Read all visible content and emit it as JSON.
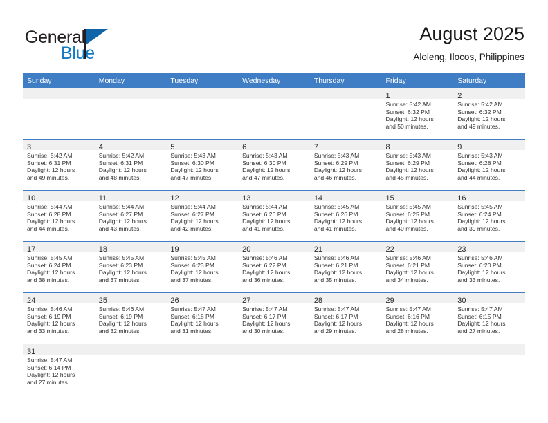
{
  "brand": {
    "name_dark": "General",
    "name_blue": "Blue",
    "flag_icon": "triangle-flag-icon",
    "accent_color": "#1279c4"
  },
  "header": {
    "title": "August 2025",
    "subtitle": "Aloleng, Ilocos, Philippines",
    "header_bg_color": "#3f7dc4",
    "daynum_strip_color": "#f0f0f0"
  },
  "weekday_headers": [
    "Sunday",
    "Monday",
    "Tuesday",
    "Wednesday",
    "Thursday",
    "Friday",
    "Saturday"
  ],
  "weeks": [
    [
      {
        "day": "",
        "lines": []
      },
      {
        "day": "",
        "lines": []
      },
      {
        "day": "",
        "lines": []
      },
      {
        "day": "",
        "lines": []
      },
      {
        "day": "",
        "lines": []
      },
      {
        "day": "1",
        "lines": [
          "Sunrise: 5:42 AM",
          "Sunset: 6:32 PM",
          "Daylight: 12 hours",
          "and 50 minutes."
        ]
      },
      {
        "day": "2",
        "lines": [
          "Sunrise: 5:42 AM",
          "Sunset: 6:32 PM",
          "Daylight: 12 hours",
          "and 49 minutes."
        ]
      }
    ],
    [
      {
        "day": "3",
        "lines": [
          "Sunrise: 5:42 AM",
          "Sunset: 6:31 PM",
          "Daylight: 12 hours",
          "and 49 minutes."
        ]
      },
      {
        "day": "4",
        "lines": [
          "Sunrise: 5:42 AM",
          "Sunset: 6:31 PM",
          "Daylight: 12 hours",
          "and 48 minutes."
        ]
      },
      {
        "day": "5",
        "lines": [
          "Sunrise: 5:43 AM",
          "Sunset: 6:30 PM",
          "Daylight: 12 hours",
          "and 47 minutes."
        ]
      },
      {
        "day": "6",
        "lines": [
          "Sunrise: 5:43 AM",
          "Sunset: 6:30 PM",
          "Daylight: 12 hours",
          "and 47 minutes."
        ]
      },
      {
        "day": "7",
        "lines": [
          "Sunrise: 5:43 AM",
          "Sunset: 6:29 PM",
          "Daylight: 12 hours",
          "and 46 minutes."
        ]
      },
      {
        "day": "8",
        "lines": [
          "Sunrise: 5:43 AM",
          "Sunset: 6:29 PM",
          "Daylight: 12 hours",
          "and 45 minutes."
        ]
      },
      {
        "day": "9",
        "lines": [
          "Sunrise: 5:43 AM",
          "Sunset: 6:28 PM",
          "Daylight: 12 hours",
          "and 44 minutes."
        ]
      }
    ],
    [
      {
        "day": "10",
        "lines": [
          "Sunrise: 5:44 AM",
          "Sunset: 6:28 PM",
          "Daylight: 12 hours",
          "and 44 minutes."
        ]
      },
      {
        "day": "11",
        "lines": [
          "Sunrise: 5:44 AM",
          "Sunset: 6:27 PM",
          "Daylight: 12 hours",
          "and 43 minutes."
        ]
      },
      {
        "day": "12",
        "lines": [
          "Sunrise: 5:44 AM",
          "Sunset: 6:27 PM",
          "Daylight: 12 hours",
          "and 42 minutes."
        ]
      },
      {
        "day": "13",
        "lines": [
          "Sunrise: 5:44 AM",
          "Sunset: 6:26 PM",
          "Daylight: 12 hours",
          "and 41 minutes."
        ]
      },
      {
        "day": "14",
        "lines": [
          "Sunrise: 5:45 AM",
          "Sunset: 6:26 PM",
          "Daylight: 12 hours",
          "and 41 minutes."
        ]
      },
      {
        "day": "15",
        "lines": [
          "Sunrise: 5:45 AM",
          "Sunset: 6:25 PM",
          "Daylight: 12 hours",
          "and 40 minutes."
        ]
      },
      {
        "day": "16",
        "lines": [
          "Sunrise: 5:45 AM",
          "Sunset: 6:24 PM",
          "Daylight: 12 hours",
          "and 39 minutes."
        ]
      }
    ],
    [
      {
        "day": "17",
        "lines": [
          "Sunrise: 5:45 AM",
          "Sunset: 6:24 PM",
          "Daylight: 12 hours",
          "and 38 minutes."
        ]
      },
      {
        "day": "18",
        "lines": [
          "Sunrise: 5:45 AM",
          "Sunset: 6:23 PM",
          "Daylight: 12 hours",
          "and 37 minutes."
        ]
      },
      {
        "day": "19",
        "lines": [
          "Sunrise: 5:45 AM",
          "Sunset: 6:23 PM",
          "Daylight: 12 hours",
          "and 37 minutes."
        ]
      },
      {
        "day": "20",
        "lines": [
          "Sunrise: 5:46 AM",
          "Sunset: 6:22 PM",
          "Daylight: 12 hours",
          "and 36 minutes."
        ]
      },
      {
        "day": "21",
        "lines": [
          "Sunrise: 5:46 AM",
          "Sunset: 6:21 PM",
          "Daylight: 12 hours",
          "and 35 minutes."
        ]
      },
      {
        "day": "22",
        "lines": [
          "Sunrise: 5:46 AM",
          "Sunset: 6:21 PM",
          "Daylight: 12 hours",
          "and 34 minutes."
        ]
      },
      {
        "day": "23",
        "lines": [
          "Sunrise: 5:46 AM",
          "Sunset: 6:20 PM",
          "Daylight: 12 hours",
          "and 33 minutes."
        ]
      }
    ],
    [
      {
        "day": "24",
        "lines": [
          "Sunrise: 5:46 AM",
          "Sunset: 6:19 PM",
          "Daylight: 12 hours",
          "and 33 minutes."
        ]
      },
      {
        "day": "25",
        "lines": [
          "Sunrise: 5:46 AM",
          "Sunset: 6:19 PM",
          "Daylight: 12 hours",
          "and 32 minutes."
        ]
      },
      {
        "day": "26",
        "lines": [
          "Sunrise: 5:47 AM",
          "Sunset: 6:18 PM",
          "Daylight: 12 hours",
          "and 31 minutes."
        ]
      },
      {
        "day": "27",
        "lines": [
          "Sunrise: 5:47 AM",
          "Sunset: 6:17 PM",
          "Daylight: 12 hours",
          "and 30 minutes."
        ]
      },
      {
        "day": "28",
        "lines": [
          "Sunrise: 5:47 AM",
          "Sunset: 6:17 PM",
          "Daylight: 12 hours",
          "and 29 minutes."
        ]
      },
      {
        "day": "29",
        "lines": [
          "Sunrise: 5:47 AM",
          "Sunset: 6:16 PM",
          "Daylight: 12 hours",
          "and 28 minutes."
        ]
      },
      {
        "day": "30",
        "lines": [
          "Sunrise: 5:47 AM",
          "Sunset: 6:15 PM",
          "Daylight: 12 hours",
          "and 27 minutes."
        ]
      }
    ],
    [
      {
        "day": "31",
        "lines": [
          "Sunrise: 5:47 AM",
          "Sunset: 6:14 PM",
          "Daylight: 12 hours",
          "and 27 minutes."
        ]
      },
      {
        "day": "",
        "lines": []
      },
      {
        "day": "",
        "lines": []
      },
      {
        "day": "",
        "lines": []
      },
      {
        "day": "",
        "lines": []
      },
      {
        "day": "",
        "lines": []
      },
      {
        "day": "",
        "lines": []
      }
    ]
  ]
}
